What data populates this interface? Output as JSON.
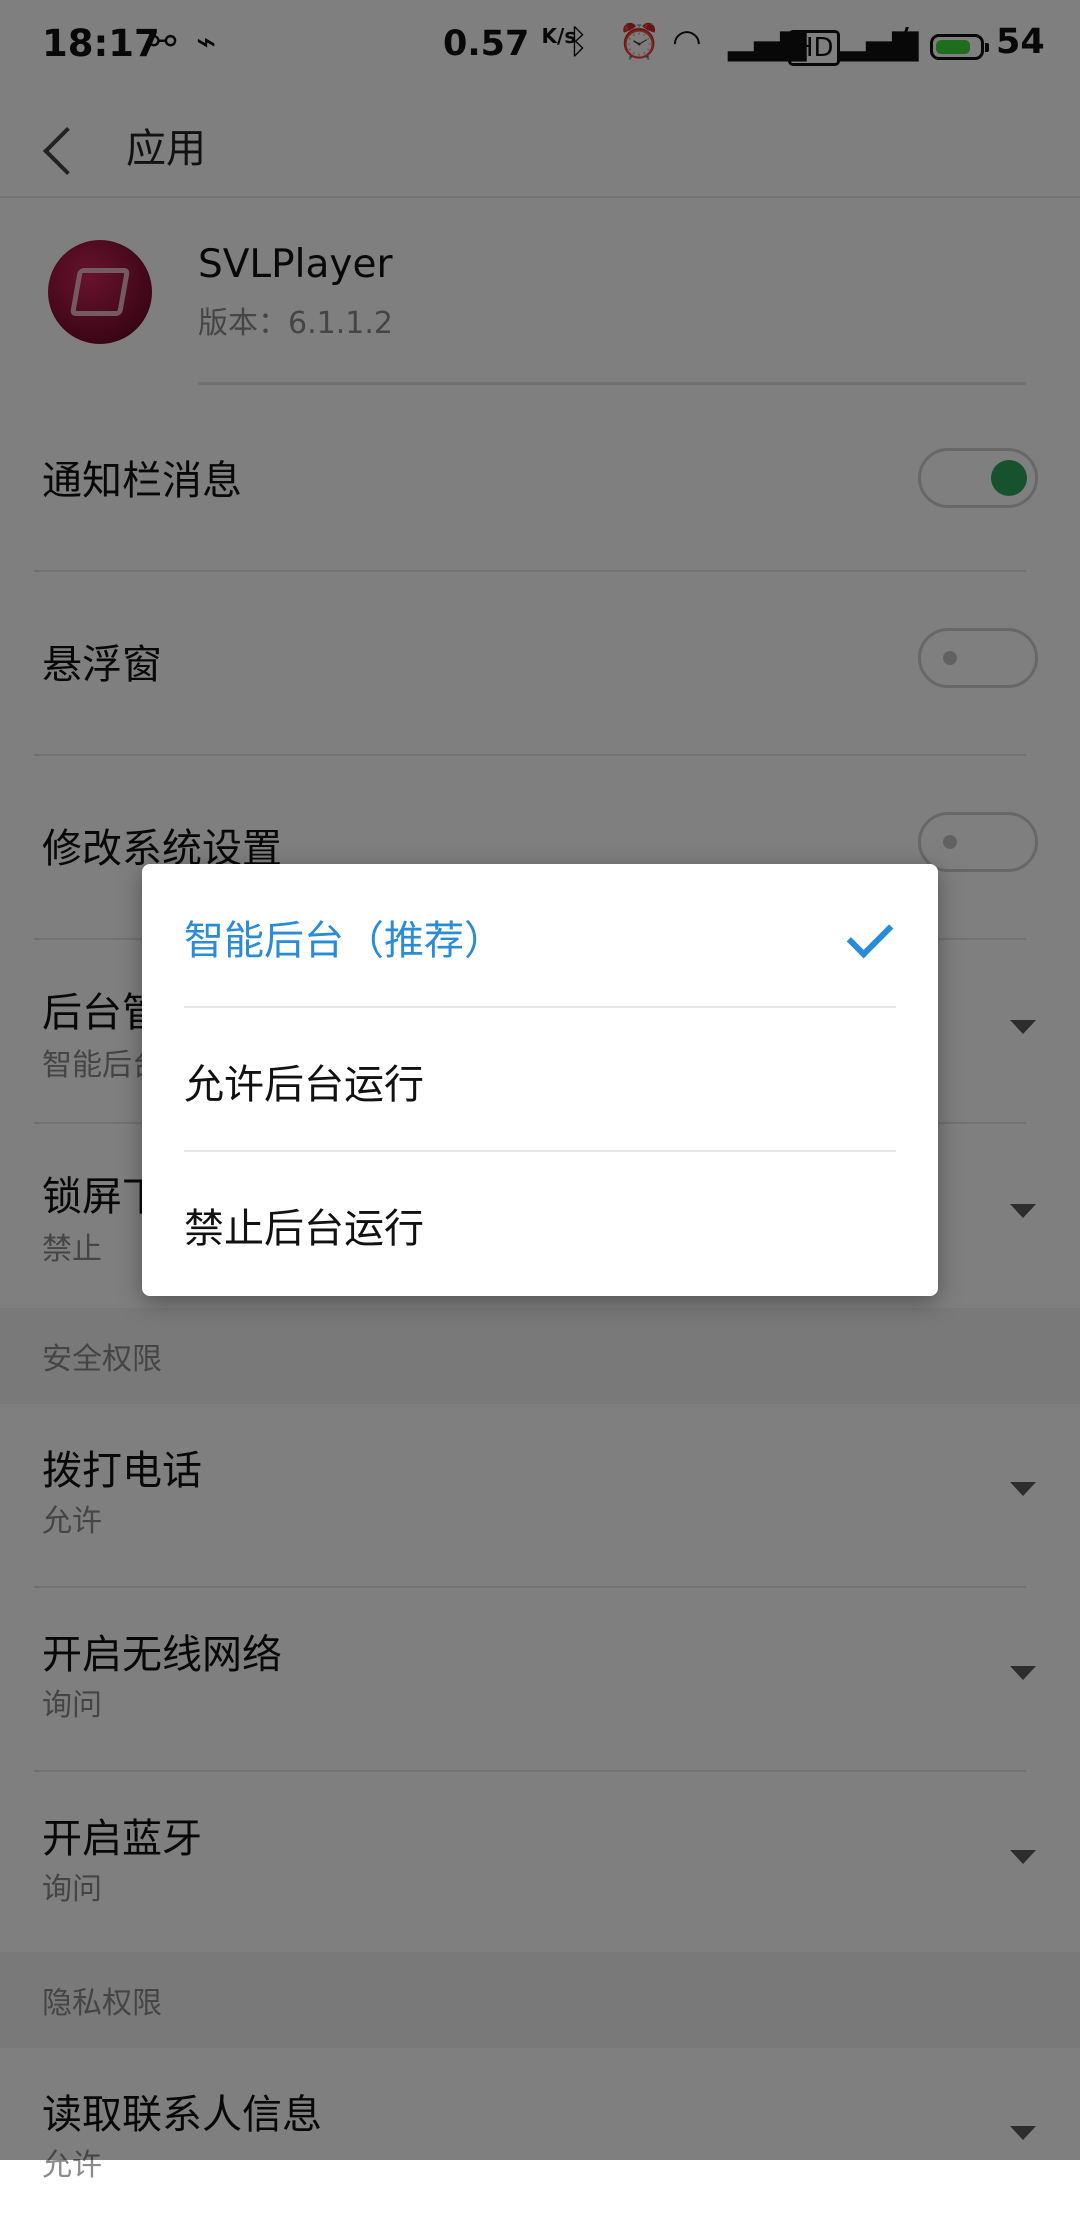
{
  "status_bar": {
    "time": "18:17",
    "speed_value": "0.57",
    "speed_unit": "K/s",
    "battery": "54",
    "icons": [
      "share-icon",
      "usb-icon",
      "bluetooth-icon",
      "alarm-icon",
      "wifi-icon",
      "signal-4g-icon",
      "hd-icon",
      "signal-4g-icon",
      "charging-icon",
      "battery-icon"
    ]
  },
  "nav": {
    "back_icon": "chevron-left-icon",
    "title": "应用"
  },
  "app": {
    "name": "SVLPlayer",
    "version": "版本：6.1.1.2"
  },
  "toggles": [
    {
      "label": "通知栏消息",
      "on": true
    },
    {
      "label": "悬浮窗",
      "on": false
    },
    {
      "label": "修改系统设置",
      "on": false
    }
  ],
  "background_rows": [
    {
      "title": "后台管",
      "sub": "智能后台"
    },
    {
      "title": "锁屏下",
      "sub": "禁止"
    }
  ],
  "section_security": "安全权限",
  "security_rows": [
    {
      "title": "拨打电话",
      "sub": "允许"
    },
    {
      "title": "开启无线网络",
      "sub": "询问"
    },
    {
      "title": "开启蓝牙",
      "sub": "询问"
    }
  ],
  "section_privacy": "隐私权限",
  "privacy_rows": [
    {
      "title": "读取联系人信息",
      "sub": "允许"
    }
  ],
  "dialog": {
    "options": [
      {
        "label": "智能后台（推荐）",
        "selected": true
      },
      {
        "label": "允许后台运行",
        "selected": false
      },
      {
        "label": "禁止后台运行",
        "selected": false
      }
    ],
    "accent": "#2a8bd6"
  }
}
